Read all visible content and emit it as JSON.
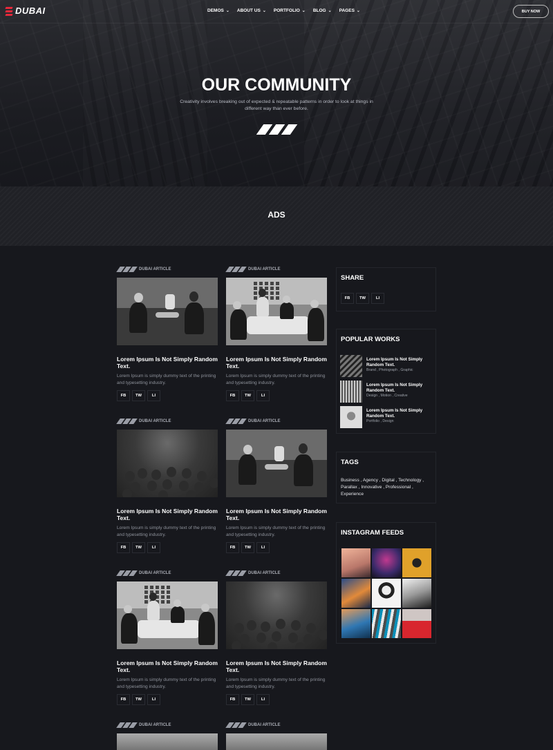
{
  "brand": {
    "logo_text": "DUBAI",
    "accent": "#e5293b"
  },
  "nav": {
    "items": [
      {
        "label": "DEMOS"
      },
      {
        "label": "ABOUT US"
      },
      {
        "label": "PORTFOLIO"
      },
      {
        "label": "BLOG"
      },
      {
        "label": "PAGES"
      }
    ],
    "cta": "BUY NOW"
  },
  "hero": {
    "title": "OUR COMMUNITY",
    "subtitle": "Creativity involves breaking out of expected & repeatable patterns in order to look at things in different way than ever before."
  },
  "ads": {
    "title": "ADS"
  },
  "articles": [
    {
      "tag": "DUBAI ARTICLE",
      "title": "Lorem Ipsum Is Not Simply Random Text.",
      "text": "Lorem Ipsum is simply dummy text of the printing and typesetting industry.",
      "share": [
        "FB",
        "TW",
        "LI"
      ],
      "image": "meeting"
    },
    {
      "tag": "DUBAI ARTICLE",
      "title": "Lorem Ipsum Is Not Simply Random Text.",
      "text": "Lorem Ipsum is simply dummy text of the printing and typesetting industry.",
      "share": [
        "FB",
        "TW",
        "LI"
      ],
      "image": "office"
    },
    {
      "tag": "DUBAI ARTICLE",
      "title": "Lorem Ipsum Is Not Simply Random Text.",
      "text": "Lorem Ipsum is simply dummy text of the printing and typesetting industry.",
      "share": [
        "FB",
        "TW",
        "LI"
      ],
      "image": "audience"
    },
    {
      "tag": "DUBAI ARTICLE",
      "title": "Lorem Ipsum Is Not Simply Random Text.",
      "text": "Lorem Ipsum is simply dummy text of the printing and typesetting industry.",
      "share": [
        "FB",
        "TW",
        "LI"
      ],
      "image": "meeting"
    },
    {
      "tag": "DUBAI ARTICLE",
      "title": "Lorem Ipsum Is Not Simply Random Text.",
      "text": "Lorem Ipsum is simply dummy text of the printing and typesetting industry.",
      "share": [
        "FB",
        "TW",
        "LI"
      ],
      "image": "office"
    },
    {
      "tag": "DUBAI ARTICLE",
      "title": "Lorem Ipsum Is Not Simply Random Text.",
      "text": "Lorem Ipsum is simply dummy text of the printing and typesetting industry.",
      "share": [
        "FB",
        "TW",
        "LI"
      ],
      "image": "audience"
    },
    {
      "tag": "DUBAI ARTICLE"
    },
    {
      "tag": "DUBAI ARTICLE"
    }
  ],
  "sidebar": {
    "share": {
      "title": "SHARE",
      "buttons": [
        "FB",
        "TW",
        "LI"
      ]
    },
    "popular": {
      "title": "POPULAR WORKS",
      "items": [
        {
          "title": "Lorem Ipsum Is Not Simply Random Text.",
          "meta": "Brand , Photograph , Graphic"
        },
        {
          "title": "Lorem Ipsum Is Not Simply Random Text.",
          "meta": "Design , Motion , Creative"
        },
        {
          "title": "Lorem Ipsum Is Not Simply Random Text.",
          "meta": "Portfolio , Design"
        }
      ]
    },
    "tags": {
      "title": "TAGS",
      "text": "Business , Agency , Digital , Technology , Parallax , Innovative , Professional , Experience"
    },
    "instagram": {
      "title": "INSTAGRAM FEEDS",
      "count": 9
    }
  }
}
